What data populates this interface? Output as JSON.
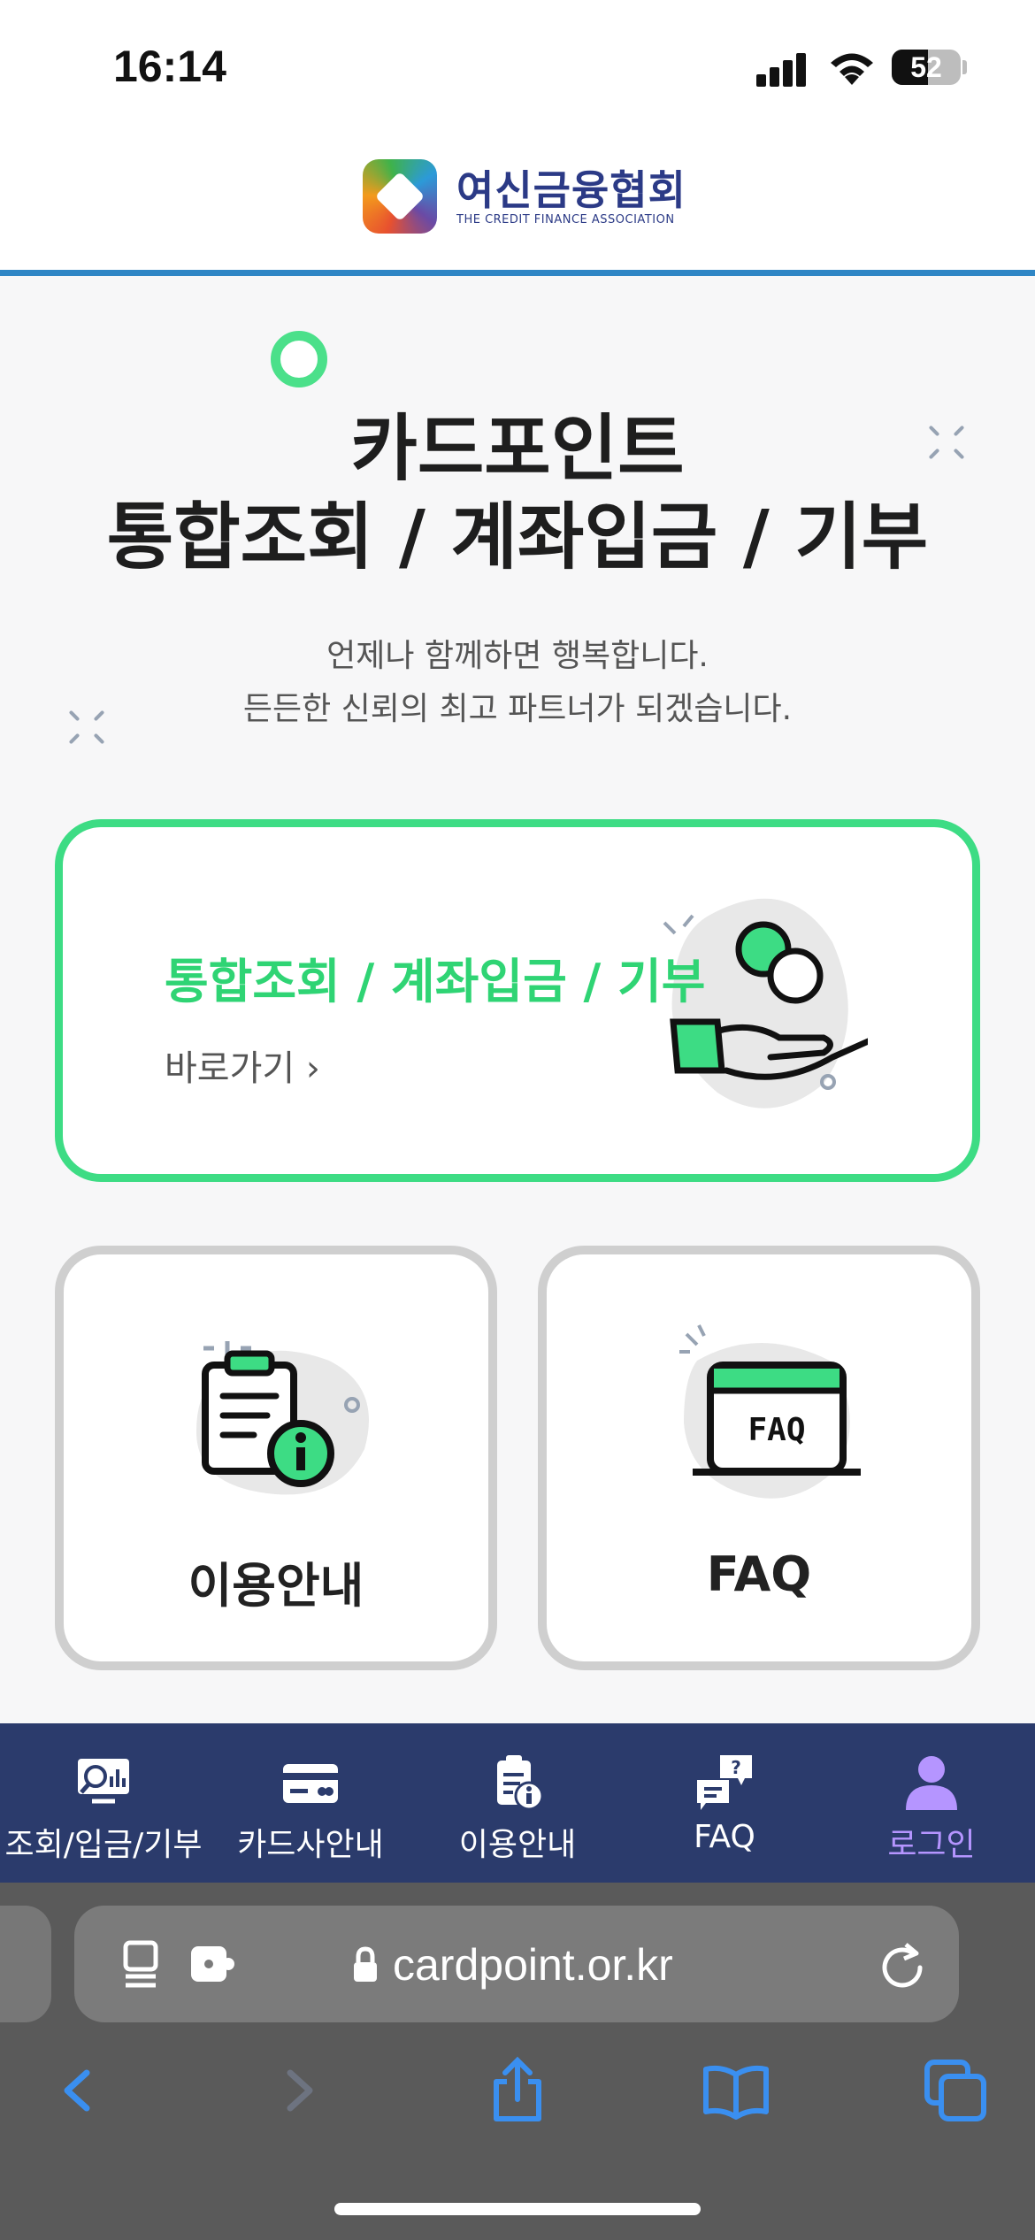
{
  "status_bar": {
    "time": "16:14",
    "battery": "52"
  },
  "header": {
    "logo_ko": "여신금융협회",
    "logo_en": "THE CREDIT FINANCE ASSOCIATION"
  },
  "hero": {
    "title_line1": "카드포인트",
    "title_line2": "통합조회 / 계좌입금 / 기부",
    "subtitle_line1": "언제나 함께하면 행복합니다.",
    "subtitle_line2": "든든한 신뢰의 최고 파트너가 되겠습니다."
  },
  "main_card": {
    "title": "통합조회 / 계좌입금 / 기부",
    "link": "바로가기 ›"
  },
  "cards": [
    {
      "label": "이용안내"
    },
    {
      "label": "FAQ"
    }
  ],
  "bottom_nav": [
    {
      "label": "조회/입금/기부",
      "icon": "search-chart-icon"
    },
    {
      "label": "카드사안내",
      "icon": "card-icon"
    },
    {
      "label": "이용안내",
      "icon": "clipboard-info-icon"
    },
    {
      "label": "FAQ",
      "icon": "faq-chat-icon"
    },
    {
      "label": "로그인",
      "icon": "person-icon",
      "active": true
    }
  ],
  "browser": {
    "url": "cardpoint.or.kr"
  },
  "colors": {
    "accent_green": "#3ddc84",
    "nav_bg": "#2b3b6c",
    "header_line": "#2f86c5",
    "active_nav": "#b595ff"
  }
}
